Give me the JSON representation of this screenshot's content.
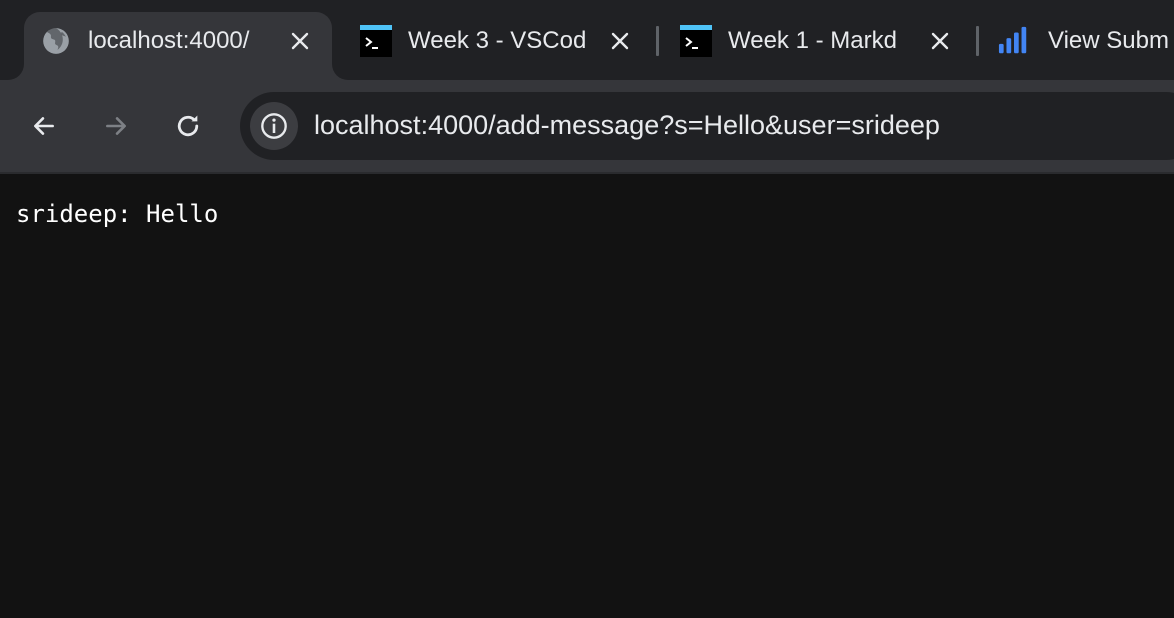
{
  "tabs": [
    {
      "title": "localhost:4000/",
      "icon": "globe-icon",
      "active": true
    },
    {
      "title": "Week 3 - VSCod",
      "icon": "terminal-icon",
      "active": false
    },
    {
      "title": "Week 1 - Markd",
      "icon": "terminal-icon",
      "active": false
    },
    {
      "title": "View Subm",
      "icon": "bar-chart-icon",
      "active": false
    }
  ],
  "toolbar": {
    "url": "localhost:4000/add-message?s=Hello&user=srideep"
  },
  "page": {
    "message": "srideep: Hello"
  },
  "colors": {
    "tab_strip": "#202124",
    "toolbar": "#35363a",
    "page_background": "#121212",
    "terminal_accent": "#4fc3f7",
    "chart_icon": "#4285f4"
  }
}
